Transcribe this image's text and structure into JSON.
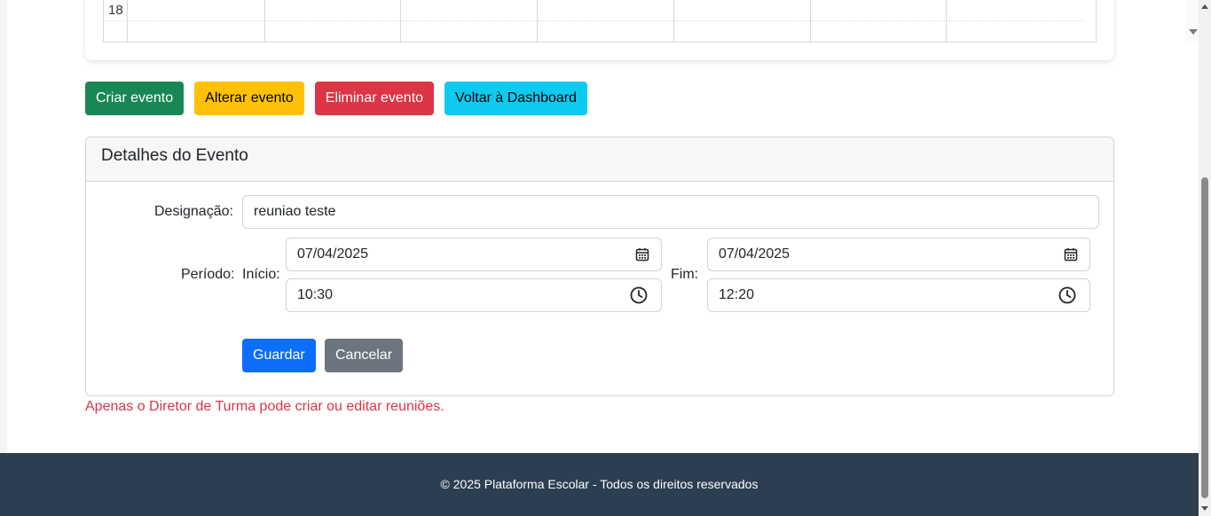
{
  "calendar": {
    "visible_hour": "18"
  },
  "actions": {
    "create": "Criar evento",
    "edit": "Alterar evento",
    "delete": "Eliminar evento",
    "back": "Voltar à Dashboard"
  },
  "details": {
    "title": "Detalhes do Evento",
    "designation_label": "Designação:",
    "designation_value": "reuniao teste",
    "period_label": "Período:",
    "start_label": "Início:",
    "start_date": "07/04/2025",
    "start_time": "10:30",
    "end_label": "Fim:",
    "end_date": "07/04/2025",
    "end_time": "12:20",
    "save": "Guardar",
    "cancel": "Cancelar"
  },
  "error_message": "Apenas o Diretor de Turma pode criar ou editar reuniões.",
  "footer": {
    "text": "© 2025 Plataforma Escolar - Todos os direitos reservados"
  },
  "icons": {
    "date": "calendar-icon",
    "time": "clock-icon"
  }
}
